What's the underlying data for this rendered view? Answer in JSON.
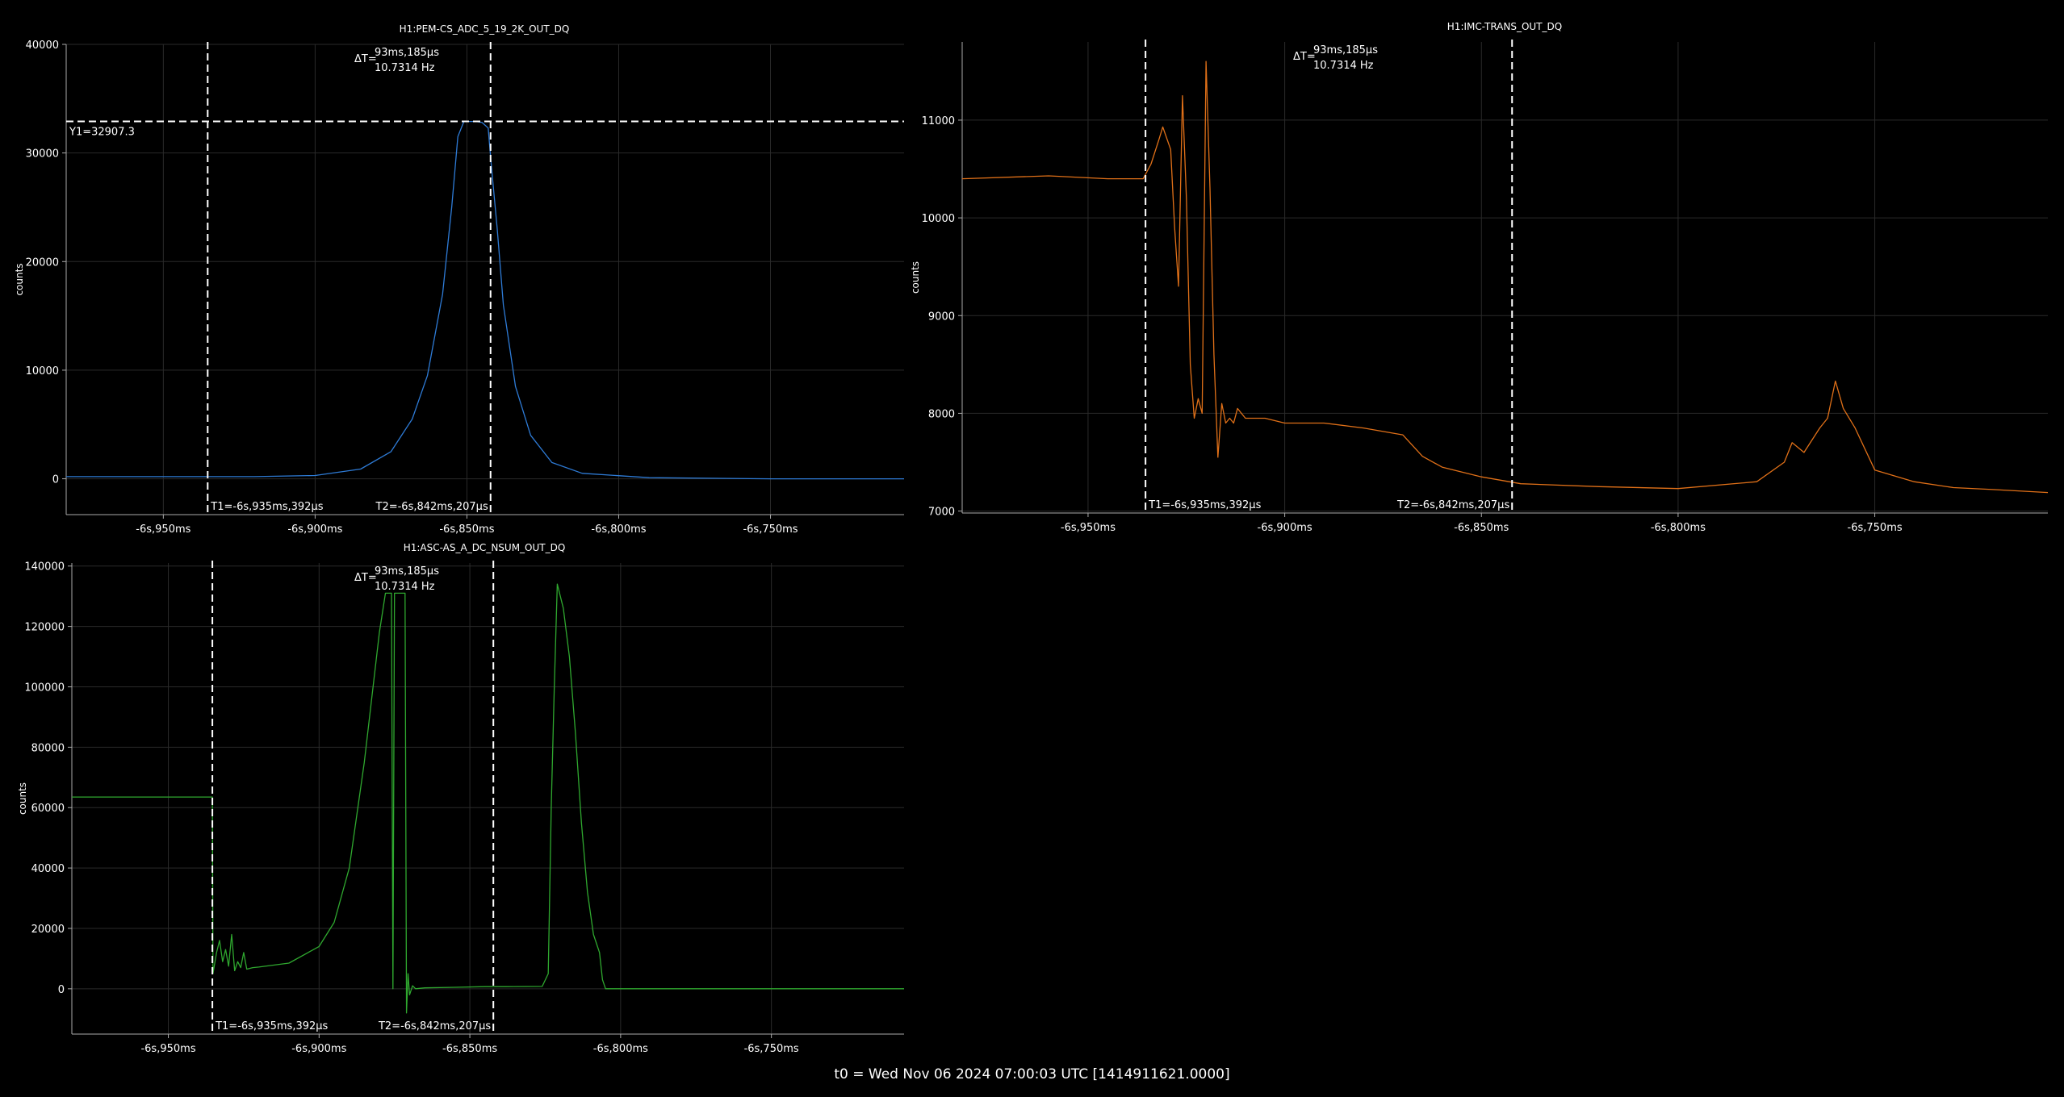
{
  "footer": "t0 = Wed Nov 06 2024 07:00:03 UTC [1414911621.0000]",
  "chart_data": [
    {
      "type": "line",
      "title": "H1:PEM-CS_ADC_5_19_2K_OUT_DQ",
      "ylabel": "counts",
      "xlim": [
        -6.982,
        -6.706
      ],
      "ylim": [
        -3300,
        40000
      ],
      "xticks": [
        -6.95,
        -6.9,
        -6.85,
        -6.8,
        -6.75
      ],
      "xtick_labels": [
        "-6s,950ms",
        "-6s,900ms",
        "-6s,850ms",
        "-6s,800ms",
        "-6s,750ms"
      ],
      "yticks": [
        0,
        10000,
        20000,
        30000,
        40000
      ],
      "ytick_labels": [
        "0",
        "10000",
        "20000",
        "30000",
        "40000"
      ],
      "grid": true,
      "color": "#2e7bd6",
      "series": [
        {
          "x": [
            -6.982,
            -6.95,
            -6.92,
            -6.9,
            -6.885,
            -6.875,
            -6.868,
            -6.863,
            -6.858,
            -6.855,
            -6.853,
            -6.851,
            -6.847,
            -6.845,
            -6.843,
            -6.842,
            -6.84,
            -6.838,
            -6.834,
            -6.829,
            -6.822,
            -6.812,
            -6.79,
            -6.75,
            -6.706
          ],
          "y": [
            200,
            200,
            200,
            300,
            900,
            2500,
            5500,
            9500,
            17000,
            25000,
            31500,
            32900,
            32900,
            32800,
            32300,
            29000,
            23000,
            16000,
            8500,
            4000,
            1500,
            500,
            100,
            0,
            0
          ]
        }
      ],
      "cursors": {
        "t1": "T1=-6s,935ms,392μs",
        "t1_x": -6.935392,
        "t2": "T2=-6s,842ms,207μs",
        "t2_x": -6.842207,
        "y1": "Y1=32907.3",
        "y1_value": 32907.3,
        "dt_label": "ΔT=",
        "dt": "93ms,185μs",
        "freq": "10.7314 Hz"
      }
    },
    {
      "type": "line",
      "title": "H1:IMC-TRANS_OUT_DQ",
      "ylabel": "counts",
      "xlim": [
        -6.982,
        -6.706
      ],
      "ylim": [
        6980,
        11800
      ],
      "xticks": [
        -6.95,
        -6.9,
        -6.85,
        -6.8,
        -6.75
      ],
      "xtick_labels": [
        "-6s,950ms",
        "-6s,900ms",
        "-6s,850ms",
        "-6s,800ms",
        "-6s,750ms"
      ],
      "yticks": [
        7000,
        8000,
        9000,
        10000,
        11000
      ],
      "ytick_labels": [
        "7000",
        "8000",
        "9000",
        "10000",
        "11000"
      ],
      "grid": true,
      "color": "#e07018",
      "series": [
        {
          "x": [
            -6.982,
            -6.96,
            -6.945,
            -6.936,
            -6.934,
            -6.932,
            -6.931,
            -6.929,
            -6.928,
            -6.927,
            -6.926,
            -6.925,
            -6.924,
            -6.923,
            -6.922,
            -6.921,
            -6.92,
            -6.919,
            -6.918,
            -6.917,
            -6.916,
            -6.915,
            -6.914,
            -6.913,
            -6.912,
            -6.91,
            -6.905,
            -6.9,
            -6.89,
            -6.88,
            -6.87,
            -6.865,
            -6.86,
            -6.85,
            -6.84,
            -6.82,
            -6.8,
            -6.78,
            -6.773,
            -6.771,
            -6.768,
            -6.764,
            -6.762,
            -6.76,
            -6.758,
            -6.755,
            -6.75,
            -6.74,
            -6.73,
            -6.72,
            -6.706
          ],
          "y": [
            10400,
            10430,
            10400,
            10400,
            10550,
            10800,
            10930,
            10700,
            9900,
            9300,
            11250,
            10200,
            8500,
            7950,
            8150,
            8000,
            11600,
            10300,
            8600,
            7550,
            8100,
            7900,
            7950,
            7900,
            8050,
            7950,
            7950,
            7900,
            7900,
            7850,
            7780,
            7560,
            7450,
            7350,
            7280,
            7250,
            7230,
            7300,
            7500,
            7700,
            7600,
            7850,
            7950,
            8330,
            8050,
            7850,
            7420,
            7300,
            7240,
            7220,
            7190
          ]
        }
      ],
      "cursors": {
        "t1": "T1=-6s,935ms,392μs",
        "t1_x": -6.935392,
        "t2": "T2=-6s,842ms,207μs",
        "t2_x": -6.842207,
        "dt_label": "ΔT=",
        "dt": "93ms,185μs",
        "freq": "10.7314 Hz"
      }
    },
    {
      "type": "line",
      "title": "H1:ASC-AS_A_DC_NSUM_OUT_DQ",
      "ylabel": "counts",
      "xlim": [
        -6.982,
        -6.706
      ],
      "ylim": [
        -15000,
        141000
      ],
      "xticks": [
        -6.95,
        -6.9,
        -6.85,
        -6.8,
        -6.75
      ],
      "xtick_labels": [
        "-6s,950ms",
        "-6s,900ms",
        "-6s,850ms",
        "-6s,800ms",
        "-6s,750ms"
      ],
      "yticks": [
        0,
        20000,
        40000,
        60000,
        80000,
        100000,
        120000,
        140000
      ],
      "ytick_labels": [
        "0",
        "20000",
        "40000",
        "60000",
        "80000",
        "100000",
        "120000",
        "140000"
      ],
      "grid": true,
      "color": "#2fa82f",
      "series": [
        {
          "x": [
            -6.982,
            -6.9354,
            -6.9352,
            -6.934,
            -6.933,
            -6.932,
            -6.931,
            -6.93,
            -6.929,
            -6.928,
            -6.927,
            -6.926,
            -6.925,
            -6.924,
            -6.922,
            -6.92,
            -6.91,
            -6.9,
            -6.895,
            -6.89,
            -6.885,
            -6.88,
            -6.878,
            -6.876,
            -6.8755,
            -6.875,
            -6.873,
            -6.8715,
            -6.871,
            -6.8705,
            -6.87,
            -6.869,
            -6.868,
            -6.865,
            -6.855,
            -6.845,
            -6.838,
            -6.826,
            -6.824,
            -6.823,
            -6.822,
            -6.821,
            -6.819,
            -6.817,
            -6.815,
            -6.813,
            -6.811,
            -6.809,
            -6.807,
            -6.806,
            -6.805,
            -6.804,
            -6.8,
            -6.75,
            -6.706
          ],
          "y": [
            63500,
            63500,
            5000,
            12000,
            16000,
            9000,
            13000,
            7500,
            18000,
            6000,
            9000,
            7000,
            12000,
            6500,
            7000,
            7200,
            8500,
            14000,
            22000,
            40000,
            75000,
            118000,
            131000,
            131000,
            0,
            131000,
            131000,
            131000,
            -8000,
            5000,
            -2000,
            1000,
            0,
            300,
            500,
            700,
            700,
            800,
            5000,
            60000,
            100000,
            134000,
            126000,
            110000,
            85000,
            55000,
            32000,
            18000,
            12000,
            3000,
            0,
            0,
            0,
            0,
            0
          ]
        }
      ],
      "cursors": {
        "t1": "T1=-6s,935ms,392μs",
        "t1_x": -6.935392,
        "t2": "T2=-6s,842ms,207μs",
        "t2_x": -6.842207,
        "dt_label": "ΔT=",
        "dt": "93ms,185μs",
        "freq": "10.7314 Hz"
      }
    }
  ]
}
